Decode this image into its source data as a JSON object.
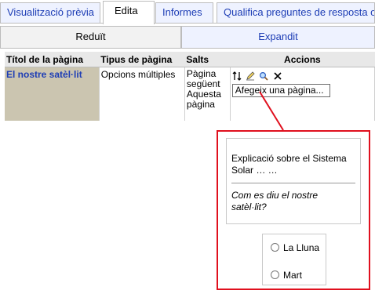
{
  "tabs_top": [
    {
      "label": "Visualització prèvia",
      "active": false
    },
    {
      "label": "Edita",
      "active": true
    },
    {
      "label": "Informes",
      "active": false
    },
    {
      "label": "Qualifica preguntes de resposta oberta",
      "active": false
    }
  ],
  "tabs_second": [
    {
      "label": "Reduït",
      "active": true
    },
    {
      "label": "Expandit",
      "active": false
    }
  ],
  "table": {
    "headers": [
      "Títol de la pàgina",
      "Tipus de pàgina",
      "Salts",
      "Accions"
    ],
    "row": {
      "title": "El nostre satèl·lit",
      "type": "Opcions múltiples",
      "jumps_line1": "Pàgina",
      "jumps_line2": "següent",
      "jumps_line3": "Aquesta",
      "jumps_line4": "pàgina",
      "add_page_select": "Afegeix una pàgina..."
    },
    "action_icons": [
      "move-icon",
      "edit-icon",
      "preview-icon",
      "delete-icon"
    ]
  },
  "preview": {
    "description": "Explicació sobre el Sistema Solar … …",
    "question": "Com es diu el nostre satèl·lit?",
    "options": [
      "La Lluna",
      "Mart"
    ]
  },
  "colors": {
    "link": "#1d3db5",
    "highlight_border": "#e0101e",
    "title_cell_bg": "#cbc5b0"
  }
}
